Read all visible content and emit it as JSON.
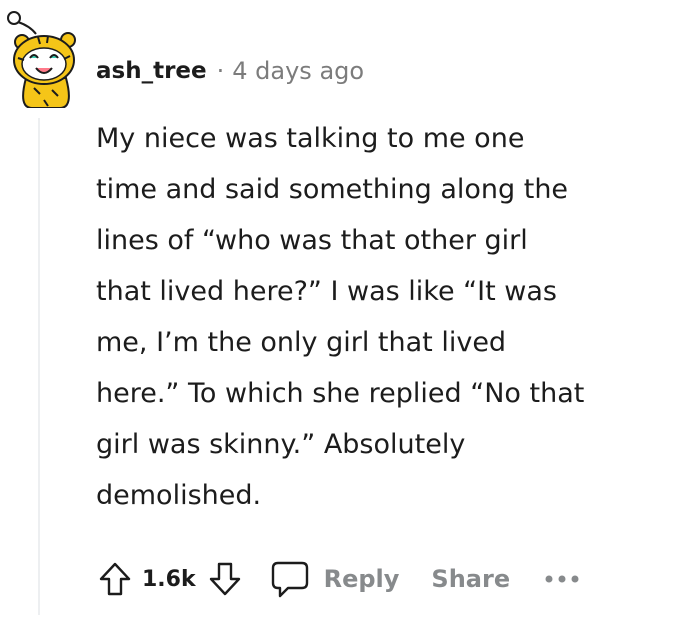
{
  "comment": {
    "username": "ash_tree",
    "separator": "·",
    "timestamp": "4 days ago",
    "body_lines": [
      "My niece was talking to me one",
      "time and said something along the",
      "lines of “who was that other girl",
      "that lived here?” I was like “It was",
      "me, I’m the only girl that lived",
      "here.” To which she replied “No that",
      "girl was skinny.” Absolutely",
      "demolished."
    ],
    "score": "1.6k",
    "reply_label": "Reply",
    "share_label": "Share"
  },
  "icons": {
    "avatar": "snoo-tiger-avatar",
    "upvote": "upvote-arrow-icon",
    "downvote": "downvote-arrow-icon",
    "reply": "speech-bubble-icon",
    "more": "more-options-icon"
  },
  "colors": {
    "text": "#1c1c1c",
    "meta": "#7c7c7c",
    "action": "#878a8c",
    "thread_line": "#edeff1",
    "avatar_yellow": "#f5c518"
  }
}
